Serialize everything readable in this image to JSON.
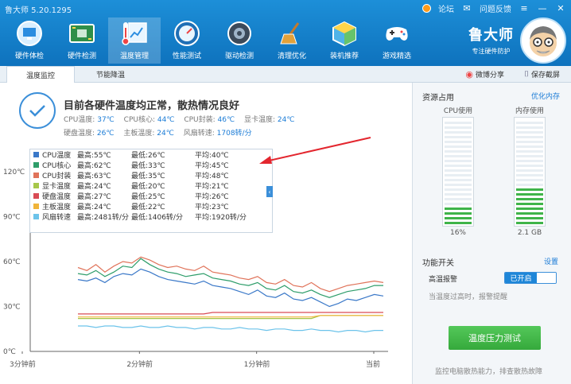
{
  "app": {
    "title": "鲁大师 5.20.1295"
  },
  "topbar": {
    "links": [
      "论坛",
      "问题反馈"
    ],
    "nav": [
      {
        "label": "硬件体检",
        "icon": "monitor-check-icon"
      },
      {
        "label": "硬件检测",
        "icon": "circuit-board-icon"
      },
      {
        "label": "温度管理",
        "icon": "thermometer-chart-icon"
      },
      {
        "label": "性能测试",
        "icon": "speedometer-icon"
      },
      {
        "label": "驱动检测",
        "icon": "gear-drive-icon"
      },
      {
        "label": "清理优化",
        "icon": "broom-icon"
      },
      {
        "label": "装机推荐",
        "icon": "cube-icon"
      },
      {
        "label": "游戏精选",
        "icon": "gamepad-icon"
      }
    ],
    "brand_name": "鲁大师",
    "brand_tagline": "专注硬件防护"
  },
  "subtabs": {
    "tab1": "温度监控",
    "tab2": "节能降温",
    "share": "微博分享",
    "screenshot": "保存截屏"
  },
  "status": {
    "title": "目前各硬件温度均正常，散热情况良好",
    "line1": [
      {
        "label": "CPU温度:",
        "value": "37℃"
      },
      {
        "label": "CPU核心:",
        "value": "44℃"
      },
      {
        "label": "CPU封装:",
        "value": "46℃"
      },
      {
        "label": "显卡温度:",
        "value": "24℃"
      }
    ],
    "line2": [
      {
        "label": "硬盘温度:",
        "value": "26℃"
      },
      {
        "label": "主板温度:",
        "value": "24℃"
      },
      {
        "label": "风扇转速:",
        "value": "1708转/分"
      }
    ]
  },
  "legend": [
    {
      "name": "CPU温度",
      "max": "最高:55℃",
      "min": "最低:26℃",
      "avg": "平均:40℃",
      "color": "#3a78c8"
    },
    {
      "name": "CPU核心",
      "max": "最高:62℃",
      "min": "最低:33℃",
      "avg": "平均:45℃",
      "color": "#2e9d6a"
    },
    {
      "name": "CPU封装",
      "max": "最高:63℃",
      "min": "最低:35℃",
      "avg": "平均:48℃",
      "color": "#e0735a"
    },
    {
      "name": "显卡温度",
      "max": "最高:24℃",
      "min": "最低:20℃",
      "avg": "平均:21℃",
      "color": "#a7c74a"
    },
    {
      "name": "硬盘温度",
      "max": "最高:27℃",
      "min": "最低:25℃",
      "avg": "平均:26℃",
      "color": "#d94b55"
    },
    {
      "name": "主板温度",
      "max": "最高:24℃",
      "min": "最低:22℃",
      "avg": "平均:23℃",
      "color": "#f0b43a"
    },
    {
      "name": "风扇转速",
      "max": "最高:2481转/分",
      "min": "最低:1406转/分",
      "avg": "平均:1920转/分",
      "color": "#6cc3ea"
    }
  ],
  "chart_data": {
    "type": "line",
    "y_ticks": [
      "120℃",
      "90℃",
      "60℃",
      "30℃",
      "0℃"
    ],
    "ylim": [
      0,
      120
    ],
    "x_ticks": [
      "3分钟前",
      "2分钟前",
      "1分钟前",
      "当前"
    ],
    "series": [
      {
        "name": "CPU温度",
        "color": "#3a78c8",
        "values": [
          48,
          47,
          49,
          46,
          50,
          52,
          51,
          55,
          53,
          50,
          48,
          47,
          46,
          45,
          47,
          44,
          43,
          42,
          40,
          38,
          41,
          37,
          36,
          39,
          35,
          34,
          36,
          33,
          30,
          32,
          35,
          34,
          36,
          38,
          37
        ]
      },
      {
        "name": "CPU核心",
        "color": "#2e9d6a",
        "values": [
          52,
          51,
          54,
          50,
          53,
          57,
          56,
          62,
          58,
          55,
          53,
          52,
          50,
          51,
          52,
          49,
          48,
          47,
          45,
          44,
          46,
          42,
          41,
          44,
          40,
          39,
          41,
          38,
          36,
          38,
          40,
          41,
          42,
          44,
          44
        ]
      },
      {
        "name": "CPU封装",
        "color": "#e0735a",
        "values": [
          56,
          54,
          58,
          53,
          57,
          60,
          59,
          63,
          61,
          58,
          56,
          57,
          55,
          54,
          57,
          53,
          52,
          51,
          49,
          48,
          50,
          46,
          45,
          48,
          44,
          43,
          46,
          42,
          40,
          42,
          44,
          45,
          46,
          47,
          46
        ]
      },
      {
        "name": "显卡温度",
        "color": "#a7c74a",
        "values": [
          22,
          22,
          22,
          22,
          22,
          22,
          22,
          22,
          22,
          22,
          22,
          22,
          22,
          22,
          22,
          22,
          22,
          22,
          22,
          22,
          22,
          22,
          22,
          22,
          22,
          22,
          22,
          24,
          24,
          24,
          24,
          24,
          24,
          24,
          24
        ]
      },
      {
        "name": "硬盘温度",
        "color": "#d94b55",
        "values": [
          25,
          25,
          25,
          25,
          25,
          25,
          25,
          25,
          25,
          25,
          25,
          25,
          25,
          25,
          25,
          26,
          26,
          26,
          26,
          26,
          26,
          26,
          26,
          26,
          26,
          26,
          26,
          26,
          26,
          26,
          26,
          26,
          26,
          26,
          26
        ]
      },
      {
        "name": "主板温度",
        "color": "#f0b43a",
        "values": [
          23,
          23,
          23,
          23,
          23,
          23,
          23,
          23,
          23,
          23,
          23,
          23,
          23,
          23,
          23,
          23,
          23,
          23,
          23,
          23,
          23,
          23,
          23,
          23,
          23,
          23,
          23,
          24,
          24,
          24,
          24,
          24,
          24,
          24,
          24
        ]
      },
      {
        "name": "风扇转速",
        "color": "#6cc3ea",
        "values": [
          17,
          17,
          16,
          17,
          17,
          16,
          16,
          17,
          16,
          16,
          17,
          16,
          16,
          15,
          16,
          16,
          15,
          15,
          16,
          15,
          15,
          14,
          15,
          15,
          14,
          14,
          15,
          14,
          14,
          13,
          14,
          14,
          13,
          14,
          14
        ]
      }
    ]
  },
  "right_panel": {
    "title": "资源占用",
    "optimize": "优化内存",
    "cpu": {
      "label": "CPU使用",
      "value": "16%",
      "fraction": 0.16
    },
    "mem": {
      "label": "内存使用",
      "value": "2.1 GB",
      "fraction": 0.35
    },
    "switch_title": "功能开关",
    "settings": "设置",
    "alarm_label": "高温报警",
    "alarm_state": "已开启",
    "alarm_hint": "当温度过高时，报警提醒",
    "test_button": "温度压力测试",
    "footer": "监控电脑散热能力，排查散热故障",
    "accent": "#1e86d8",
    "green": "#3fb449"
  }
}
